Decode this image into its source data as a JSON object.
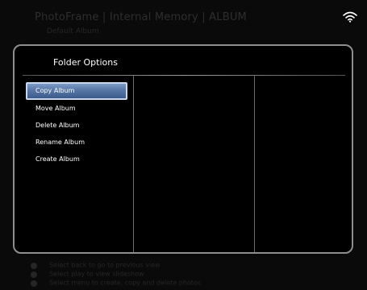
{
  "background": {
    "breadcrumb": "PhotoFrame | Internal Memory | ALBUM",
    "subtitle": "Default Album"
  },
  "status": {
    "wifi_icon": "wifi-icon"
  },
  "dialog": {
    "title": "Folder Options",
    "selected_index": 0,
    "menu": [
      {
        "label": "Copy Album"
      },
      {
        "label": "Move Album"
      },
      {
        "label": "Delete Album"
      },
      {
        "label": "Rename Album"
      },
      {
        "label": "Create Album"
      }
    ]
  },
  "hints": [
    {
      "icon": "back-button-icon",
      "text": "Select back to go to previous view"
    },
    {
      "icon": "play-button-icon",
      "text": "Select play to view slideshow"
    },
    {
      "icon": "menu-button-icon",
      "text": "Select menu to create, copy and delete photos"
    }
  ],
  "colors": {
    "selection": "#5676a6",
    "selection_border": "#c8d7ee",
    "dialog_border": "#8e8e8e"
  }
}
